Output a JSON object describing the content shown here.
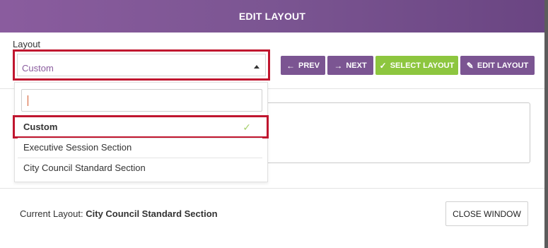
{
  "modal": {
    "title": "EDIT LAYOUT"
  },
  "layout": {
    "label": "Layout",
    "selected_value": "Custom"
  },
  "toolbar": {
    "prev_label": "PREV",
    "next_label": "NEXT",
    "select_label": "SELECT LAYOUT",
    "edit_label": "EDIT LAYOUT"
  },
  "dropdown": {
    "search_value": "",
    "options": [
      {
        "label": "Custom",
        "selected": true
      },
      {
        "label": "Executive Session Section",
        "selected": false
      },
      {
        "label": "City Council Standard Section",
        "selected": false
      }
    ]
  },
  "footer": {
    "current_layout_label": "Current Layout:",
    "current_layout_value": "City Council Standard Section",
    "close_label": "CLOSE WINDOW"
  },
  "colors": {
    "header": "#7b5592",
    "highlight": "#c0162f",
    "select_button": "#8dc63f",
    "purple_button": "#7b5592"
  },
  "icons": {
    "prev": "arrow-left-icon",
    "next": "arrow-right-icon",
    "select": "check-icon",
    "edit": "pencil-icon",
    "selected_option": "check-icon"
  }
}
